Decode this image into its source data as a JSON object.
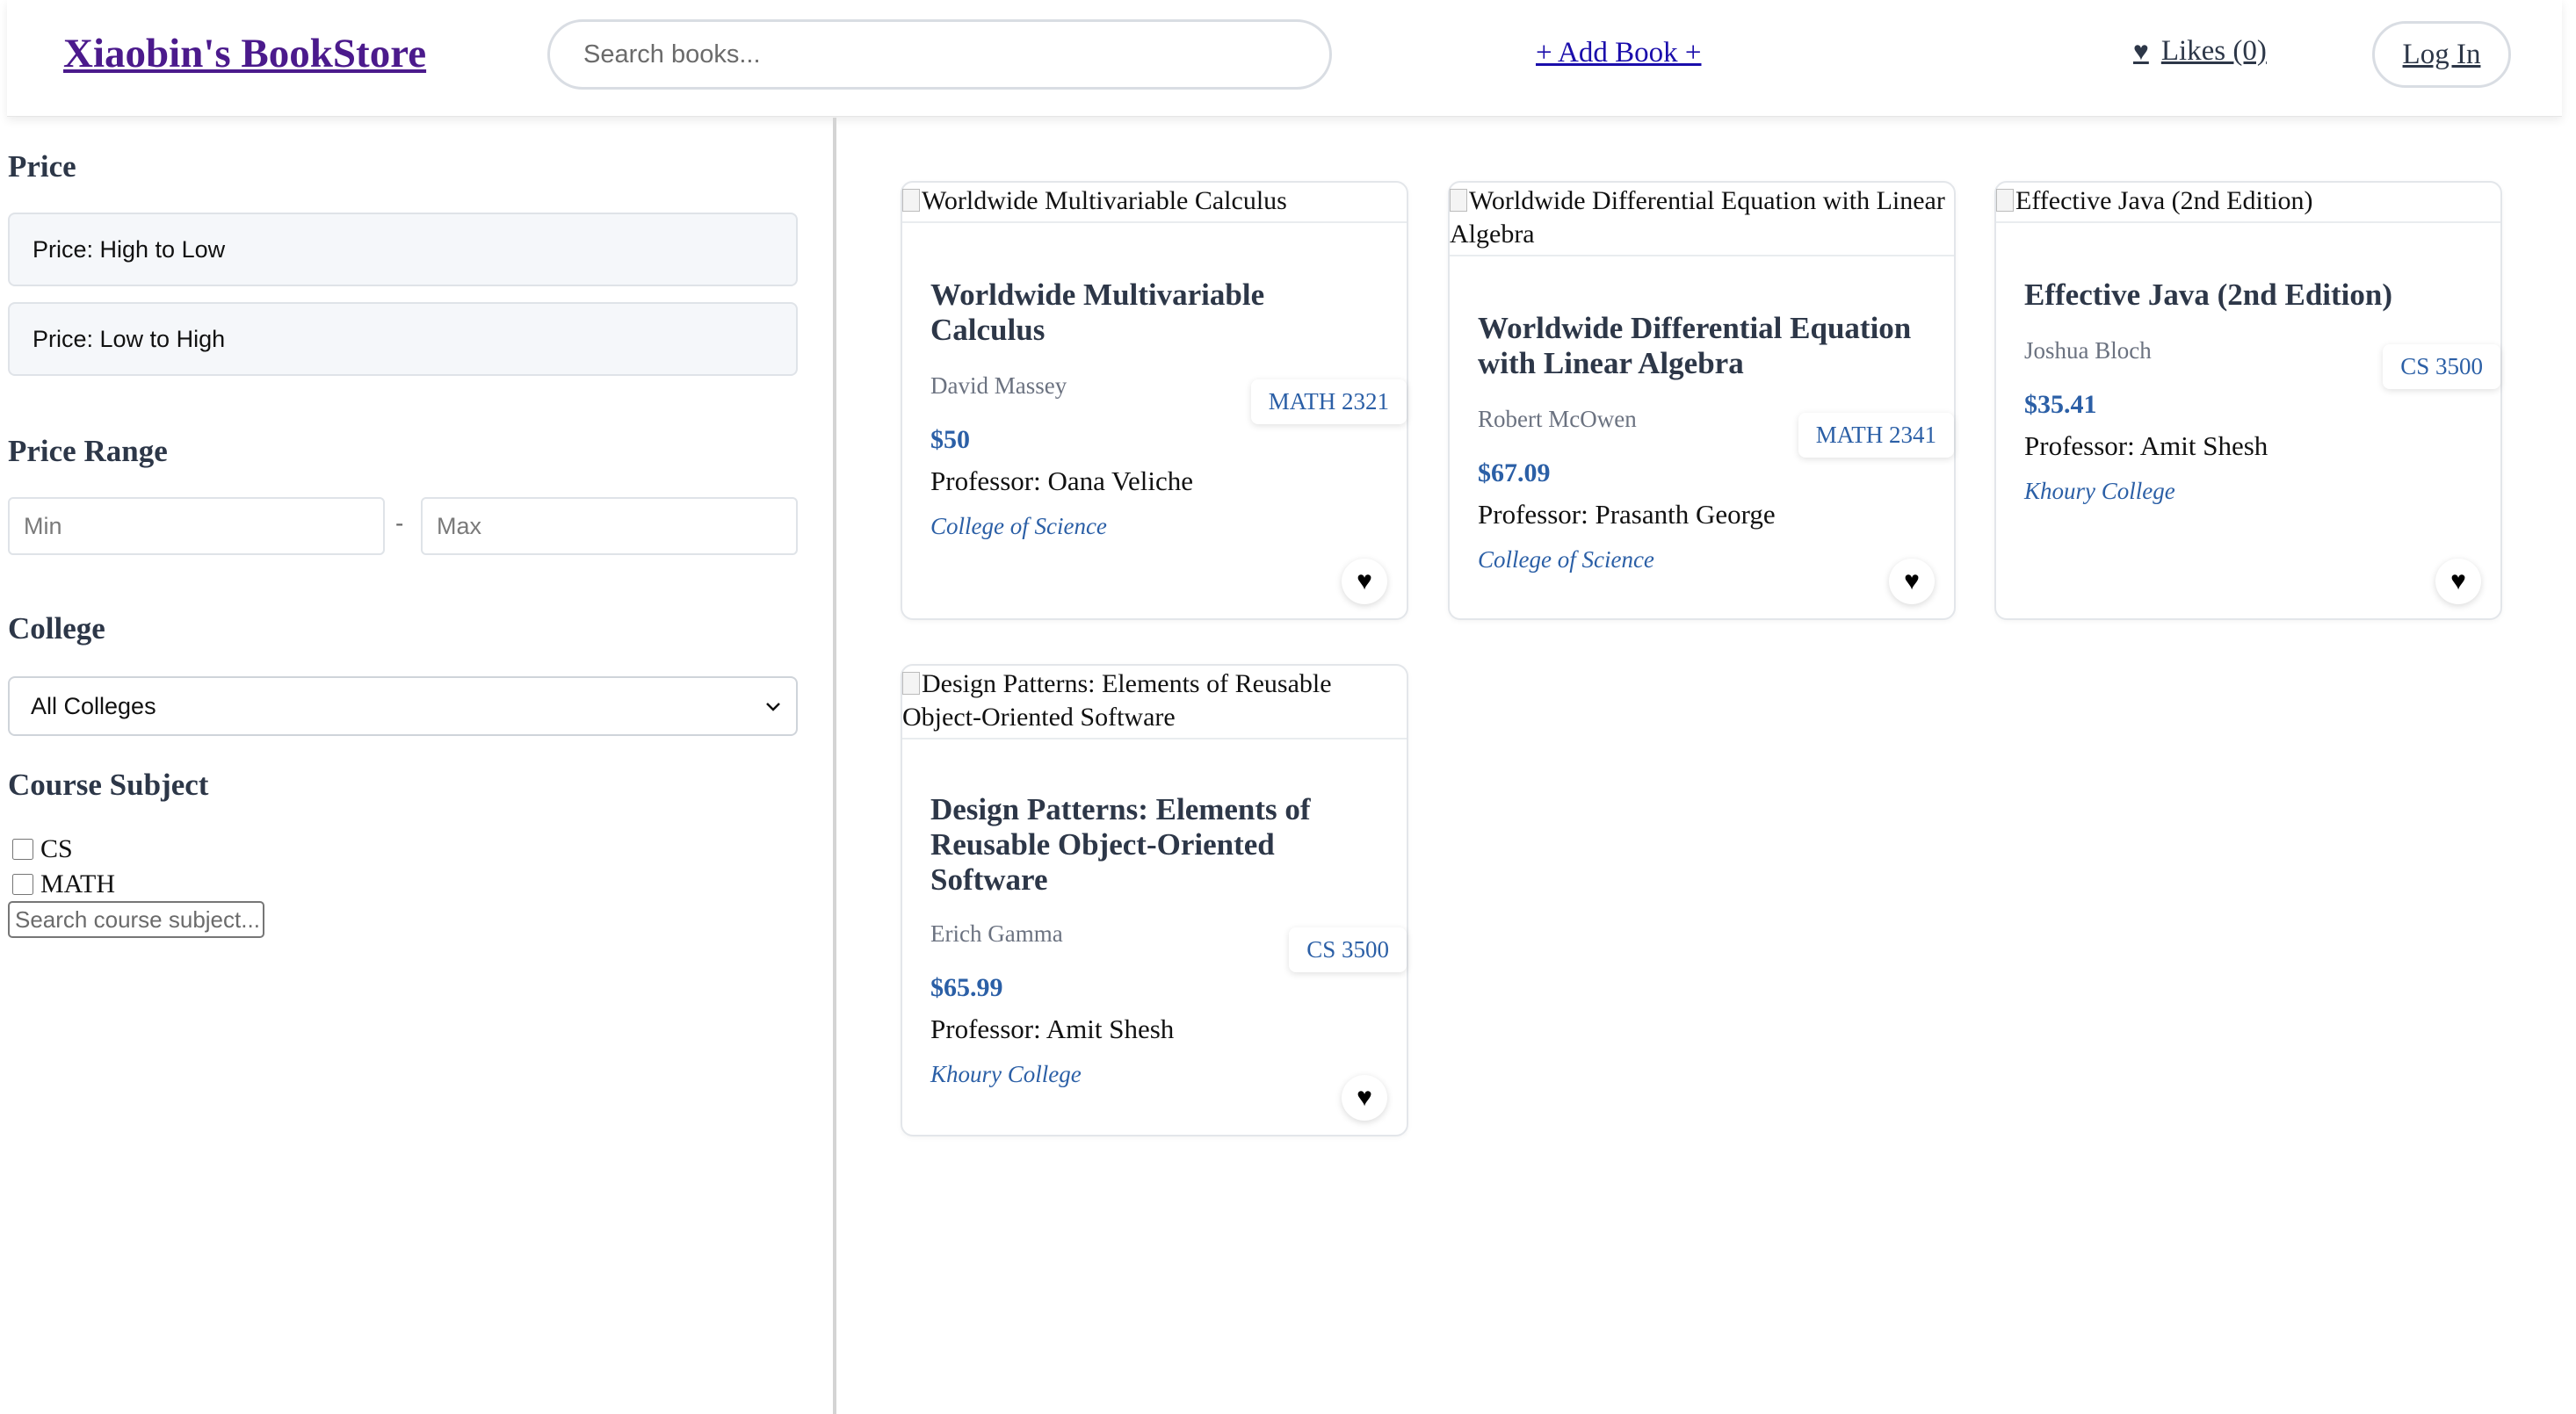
{
  "header": {
    "brand": "Xiaobin's BookStore",
    "search_placeholder": "Search books...",
    "add_book": "+ Add Book +",
    "likes_icon": "heart-icon",
    "likes_label": "Likes (0)",
    "login": "Log In"
  },
  "sidebar": {
    "price_title": "Price",
    "sort_options": [
      "Price: High to Low",
      "Price: Low to High"
    ],
    "range_title": "Price Range",
    "min_placeholder": "Min",
    "range_separator": "-",
    "max_placeholder": "Max",
    "college_title": "College",
    "college_selected": "All Colleges",
    "subject_title": "Course Subject",
    "subjects": [
      {
        "label": "CS",
        "checked": false
      },
      {
        "label": "MATH",
        "checked": false
      }
    ],
    "subject_search_placeholder": "Search course subject..."
  },
  "books": [
    {
      "image_alt": "Worldwide Multivariable Calculus",
      "title": "Worldwide Multivariable Calculus",
      "author": "David Massey",
      "course": "MATH 2321",
      "price": "$50",
      "professor": "Professor: Oana Veliche",
      "college": "College of Science"
    },
    {
      "image_alt": "Worldwide Differential Equation with Linear Algebra",
      "title": "Worldwide Differential Equation with Linear Algebra",
      "author": "Robert McOwen",
      "course": "MATH 2341",
      "price": "$67.09",
      "professor": "Professor: Prasanth George",
      "college": "College of Science"
    },
    {
      "image_alt": "Effective Java (2nd Edition)",
      "title": "Effective Java (2nd Edition)",
      "author": "Joshua Bloch",
      "course": "CS 3500",
      "price": "$35.41",
      "professor": "Professor: Amit Shesh",
      "college": "Khoury College"
    },
    {
      "image_alt": "Design Patterns: Elements of Reusable Object-Oriented Software",
      "title": "Design Patterns: Elements of Reusable Object-Oriented Software",
      "author": "Erich Gamma",
      "course": "CS 3500",
      "price": "$65.99",
      "professor": "Professor: Amit Shesh",
      "college": "Khoury College"
    }
  ],
  "colors": {
    "brand": "#4b1a8c",
    "link": "#1a0dab",
    "accent_blue": "#2b5fa6",
    "heading": "#2d3748"
  }
}
